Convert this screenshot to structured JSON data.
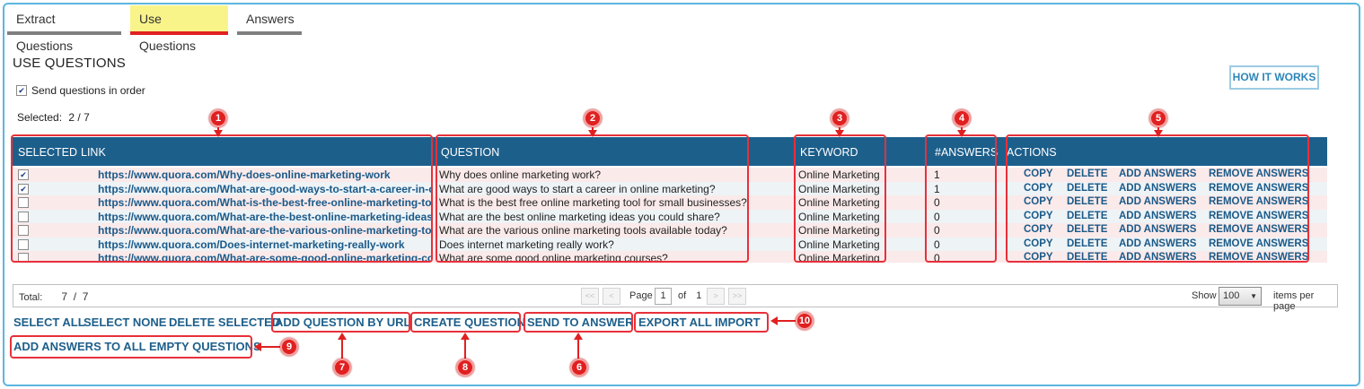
{
  "tabs": [
    {
      "label": "Extract Questions"
    },
    {
      "label": "Use Questions"
    },
    {
      "label": "Answers"
    }
  ],
  "page": {
    "title": "USE QUESTIONS",
    "send_in_order_label": "Send questions in order",
    "selected_label": "Selected:",
    "selected_value": "2 / 7",
    "how_it_works": "HOW IT WORKS"
  },
  "grid": {
    "columns": [
      "SELECTED",
      "LINK",
      "QUESTION",
      "KEYWORD",
      "#ANSWERS",
      "ACTIONS"
    ],
    "action_labels": [
      "COPY",
      "DELETE",
      "ADD ANSWERS",
      "REMOVE ANSWERS"
    ],
    "rows": [
      {
        "selected": true,
        "link": "https://www.quora.com/Why-does-online-marketing-work",
        "question": "Why does online marketing work?",
        "keyword": "Online Marketing",
        "answers": "1"
      },
      {
        "selected": true,
        "link": "https://www.quora.com/What-are-good-ways-to-start-a-career-in-online-marketing",
        "question": "What are good ways to start a career in online marketing?",
        "keyword": "Online Marketing",
        "answers": "1"
      },
      {
        "selected": false,
        "link": "https://www.quora.com/What-is-the-best-free-online-marketing-tool-for-small-businesses",
        "question": "What is the best free online marketing tool for small businesses?",
        "keyword": "Online Marketing",
        "answers": "0"
      },
      {
        "selected": false,
        "link": "https://www.quora.com/What-are-the-best-online-marketing-ideas-you-could-share",
        "question": "What are the best online marketing ideas you could share?",
        "keyword": "Online Marketing",
        "answers": "0"
      },
      {
        "selected": false,
        "link": "https://www.quora.com/What-are-the-various-online-marketing-tools-available-today",
        "question": "What are the various online marketing tools available today?",
        "keyword": "Online Marketing",
        "answers": "0"
      },
      {
        "selected": false,
        "link": "https://www.quora.com/Does-internet-marketing-really-work",
        "question": "Does internet marketing really work?",
        "keyword": "Online Marketing",
        "answers": "0"
      },
      {
        "selected": false,
        "link": "https://www.quora.com/What-are-some-good-online-marketing-courses",
        "question": "What are some good online marketing courses?",
        "keyword": "Online Marketing",
        "answers": "0"
      }
    ]
  },
  "pager": {
    "total_label": "Total:",
    "total_value": "7  /  7",
    "page_label": "Page",
    "page_value": "1",
    "of_label": "of",
    "of_value": "1",
    "show_label": "Show",
    "show_value": "100",
    "items_per_page": "items per page",
    "first": "<<",
    "prev": "<",
    "next": ">",
    "last": ">>"
  },
  "actions": {
    "select_all": "SELECT ALL",
    "select_none": "SELECT NONE",
    "delete_selected": "DELETE SELECTED",
    "add_by_url": "ADD QUESTION BY URL",
    "create_question": "CREATE QUESTION",
    "send_to_answer": "SEND TO ANSWER",
    "export_all": "EXPORT ALL",
    "import": "IMPORT",
    "add_answers_empty": "ADD ANSWERS TO ALL EMPTY QUESTIONS"
  },
  "annotations": [
    "1",
    "2",
    "3",
    "4",
    "5",
    "6",
    "7",
    "8",
    "9",
    "10"
  ],
  "colors": {
    "header": "#1d5f8b",
    "link": "#1a5a89",
    "annotation": "#e02020",
    "active_tab": "#f8f48a"
  }
}
